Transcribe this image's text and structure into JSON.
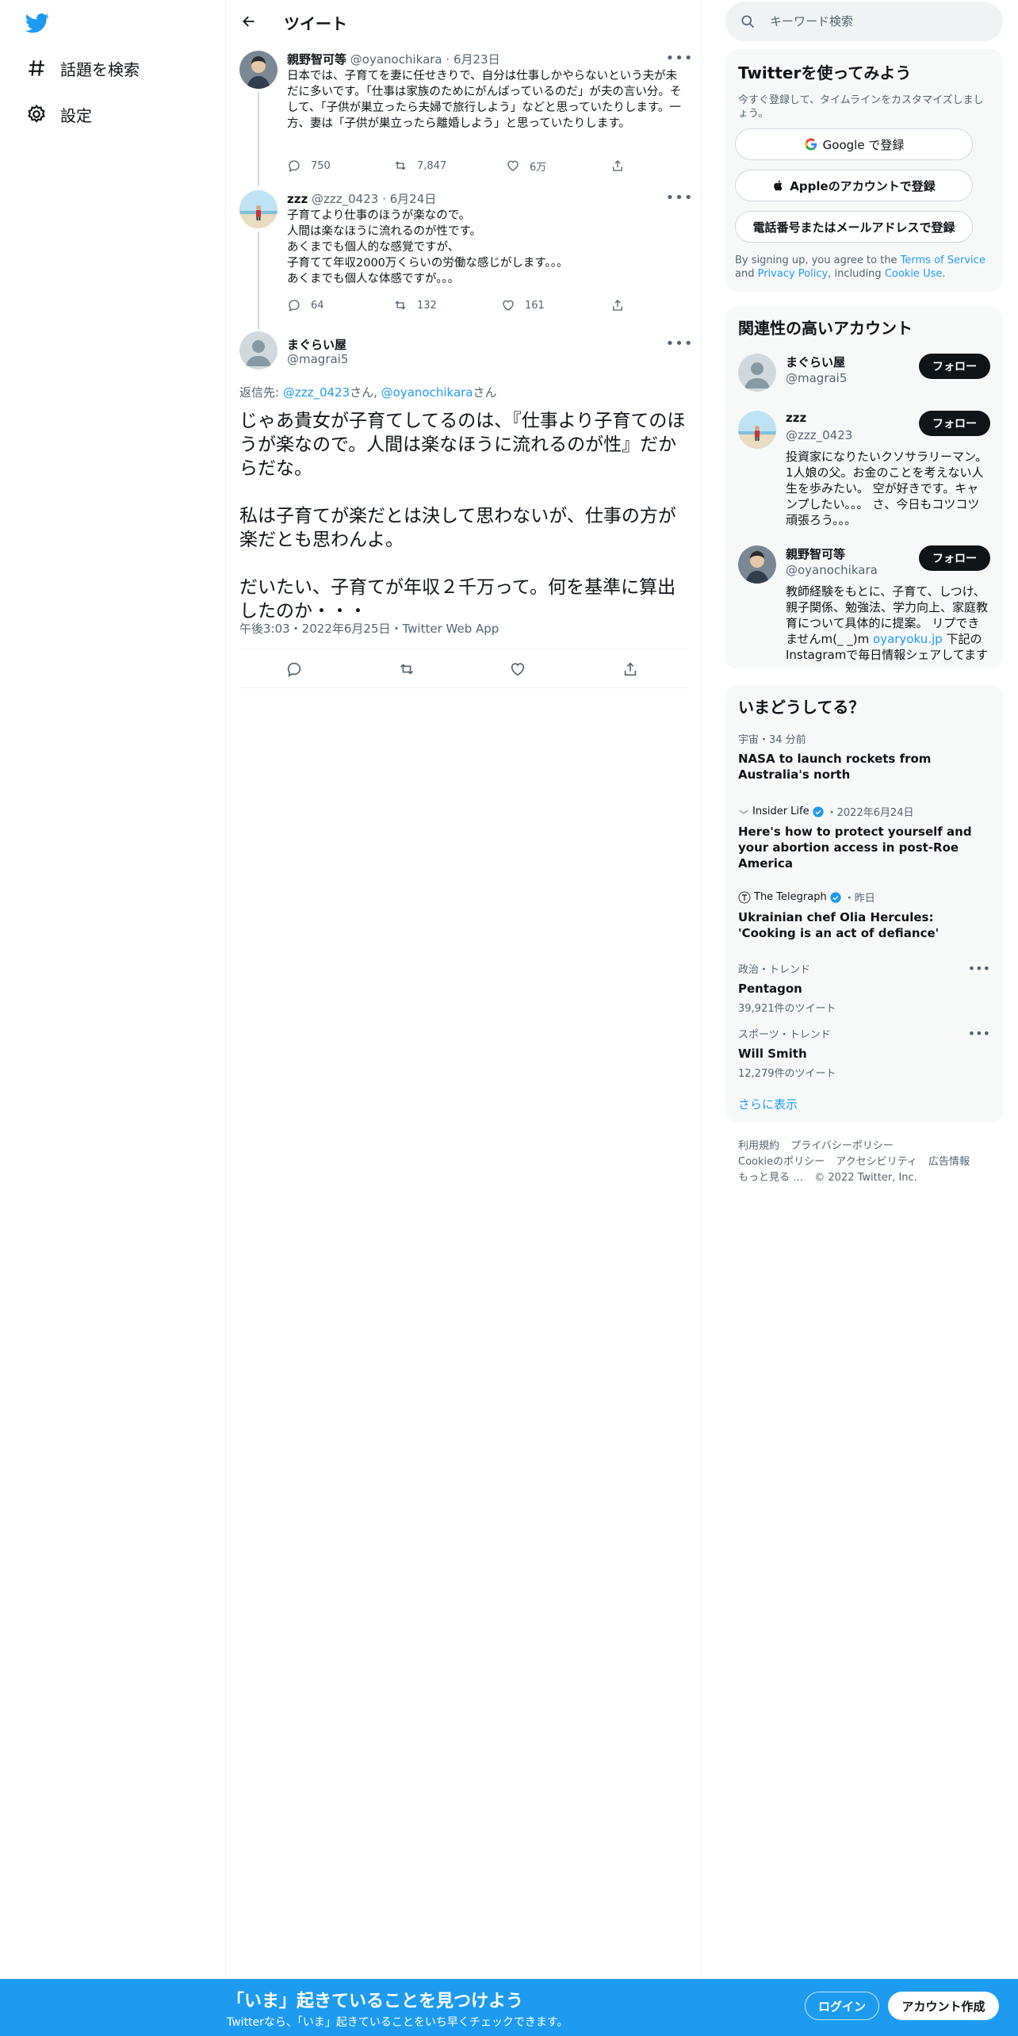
{
  "nav": {
    "items": [
      {
        "icon": "hashtag-icon",
        "label": "話題を検索"
      },
      {
        "icon": "gear-icon",
        "label": "設定"
      }
    ]
  },
  "header": {
    "title": "ツイート"
  },
  "thread": [
    {
      "name": "親野智可等",
      "handle": "@oyanochikara",
      "date": "6月23日",
      "text": "日本では、子育てを妻に任せきりで、自分は仕事しかやらないという夫が未だに多いです。「仕事は家族のためにがんばっているのだ」が夫の言い分。そして、「子供が巣立ったら夫婦で旅行しよう」などと思っていたりします。一方、妻は「子供が巣立ったら離婚しよう」と思っていたりします。",
      "replies": "750",
      "retweets": "7,847",
      "likes": "6万"
    },
    {
      "name": "zzz",
      "handle": "@zzz_0423",
      "date": "6月24日",
      "text": "子育てより仕事のほうが楽なので。\n人間は楽なほうに流れるのが性です。\nあくまでも個人的な感覚ですが、\n子育てて年収2000万くらいの労働な感じがします。。。\nあくまでも個人な体感ですが。。。",
      "replies": "64",
      "retweets": "132",
      "likes": "161"
    }
  ],
  "focus": {
    "name": "まぐらい屋",
    "handle": "@magrai5",
    "reply_prefix": "返信先: ",
    "reply_user1": "@zzz_0423",
    "reply_san1": "さん, ",
    "reply_user2": "@oyanochikara",
    "reply_san2": "さん",
    "text": "じゃあ貴女が子育てしてるのは、『仕事より子育てのほうが楽なので。人間は楽なほうに流れるのが性』だからだな。\n\n私は子育てが楽だとは決して思わないが、仕事の方が楽だとも思わんよ。\n\nだいたい、子育てが年収２千万って。何を基準に算出したのか・・・",
    "meta": "午後3:03・2022年6月25日・Twitter Web App"
  },
  "search": {
    "placeholder": "キーワード検索"
  },
  "signup": {
    "title": "Twitterを使ってみよう",
    "subtitle": "今すぐ登録して、タイムラインをカスタマイズしましょう。",
    "google": "Google で登録",
    "apple": "Appleのアカウントで登録",
    "phone": "電話番号またはメールアドレスで登録",
    "terms_1": "By signing up, you agree to the ",
    "terms_tos": "Terms of Service",
    "terms_2": " and ",
    "terms_privacy": "Privacy Policy",
    "terms_3": ", including ",
    "terms_cookie": "Cookie Use",
    "terms_4": "."
  },
  "related": {
    "title": "関連性の高いアカウント",
    "follow_label": "フォロー",
    "accounts": [
      {
        "name": "まぐらい屋",
        "handle": "@magrai5",
        "bio": ""
      },
      {
        "name": "zzz",
        "handle": "@zzz_0423",
        "bio": "投資家になりたいクソサラリーマン。1人娘の父。お金のことを考えない人生を歩みたい。 空が好きです。キャンプしたい。。。 さ、今日もコツコツ頑張ろう。。。"
      },
      {
        "name": "親野智可等",
        "handle": "@oyanochikara",
        "bio_1": "教師経験をもとに、子育て、しつけ、親子関係、勉強法、学力向上、家庭教育について具体的に提案。 リプできませんm(_ _)m ",
        "bio_link": "oyaryoku.jp",
        "bio_2": " 下記のInstagramで毎日情報シェアしてます"
      }
    ]
  },
  "trends": {
    "title": "いまどうしてる？",
    "items": [
      {
        "source": "宇宙・34 分前",
        "title": "NASA to launch rockets from Australia's north"
      },
      {
        "source_name": "Insider Life",
        "source_time": "・2022年6月24日",
        "title": "Here's how to protect yourself and your abortion access in post-Roe America"
      },
      {
        "source_name": "The Telegraph",
        "source_time": "・昨日",
        "title": "Ukrainian chef Olia Hercules: 'Cooking is an act of defiance'"
      },
      {
        "category": "政治・トレンド",
        "title": "Pentagon",
        "count": "39,921件のツイート"
      },
      {
        "category": "スポーツ・トレンド",
        "title": "Will Smith",
        "count": "12,279件のツイート"
      }
    ],
    "show_more": "さらに表示"
  },
  "footer": {
    "links": [
      "利用規約",
      "プライバシーポリシー",
      "Cookieのポリシー",
      "アクセシビリティ",
      "広告情報",
      "もっと見る …",
      "© 2022 Twitter, Inc."
    ]
  },
  "bottom_bar": {
    "title": "「いま」起きていることを見つけよう",
    "subtitle": "Twitterなら、「いま」起きていることをいち早くチェックできます。",
    "login": "ログイン",
    "signup": "アカウント作成"
  },
  "colors": {
    "accent": "#1d9bf0",
    "text": "#0f1419",
    "muted": "#536471",
    "card_bg": "#f7f9f9"
  }
}
